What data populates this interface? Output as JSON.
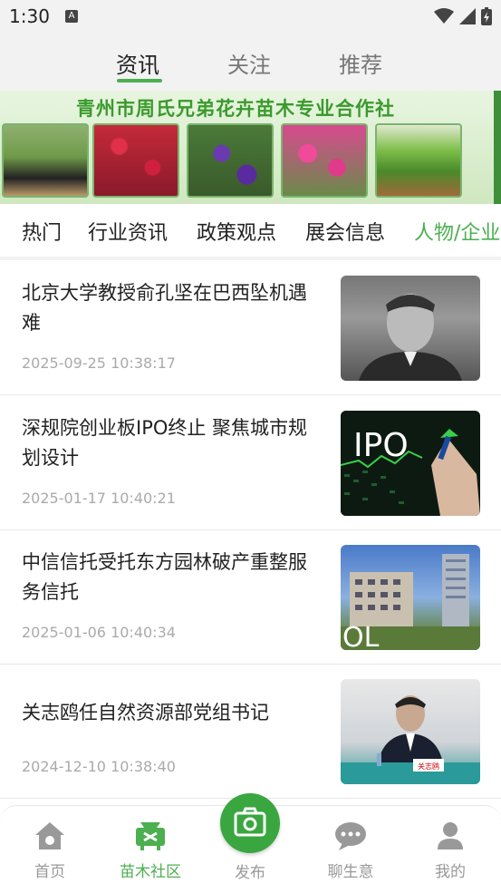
{
  "status_bar": {
    "time": "1:30",
    "notification_icon": "A"
  },
  "top_tabs": [
    {
      "label": "资讯",
      "active": true
    },
    {
      "label": "关注",
      "active": false
    },
    {
      "label": "推荐",
      "active": false
    }
  ],
  "banner": {
    "title": "青州市周氏兄弟花卉苗木专业合作社"
  },
  "categories": [
    {
      "label": "热门",
      "active": false
    },
    {
      "label": "行业资讯",
      "active": false
    },
    {
      "label": "政策观点",
      "active": false
    },
    {
      "label": "展会信息",
      "active": false
    },
    {
      "label": "人物/企业",
      "active": true
    }
  ],
  "articles": [
    {
      "title": "北京大学教授俞孔坚在巴西坠机遇难",
      "date": "2025-09-25 10:38:17",
      "thumb_icon": "portrait-photo"
    },
    {
      "title": "深规院创业板IPO终止 聚焦城市规划设计",
      "date": "2025-01-17 10:40:21",
      "thumb_icon": "ipo-photo",
      "thumb_text": "IPO"
    },
    {
      "title": "中信信托受托东方园林破产重整服务信托",
      "date": "2025-01-06 10:40:34",
      "thumb_icon": "building-photo",
      "thumb_text": "OL"
    },
    {
      "title": "关志鸥任自然资源部党组书记",
      "date": "2024-12-10 10:38:40",
      "thumb_icon": "meeting-photo",
      "thumb_text": "关志鸥"
    }
  ],
  "bottom_nav": [
    {
      "label": "首页",
      "icon": "home-icon",
      "active": false
    },
    {
      "label": "苗木社区",
      "icon": "community-icon",
      "active": true
    },
    {
      "label": "发布",
      "icon": "camera-icon",
      "active": false
    },
    {
      "label": "聊生意",
      "icon": "chat-icon",
      "active": false
    },
    {
      "label": "我的",
      "icon": "user-icon",
      "active": false
    }
  ],
  "colors": {
    "accent": "#4caf50",
    "text": "#222222",
    "muted": "#aaaaaa"
  }
}
